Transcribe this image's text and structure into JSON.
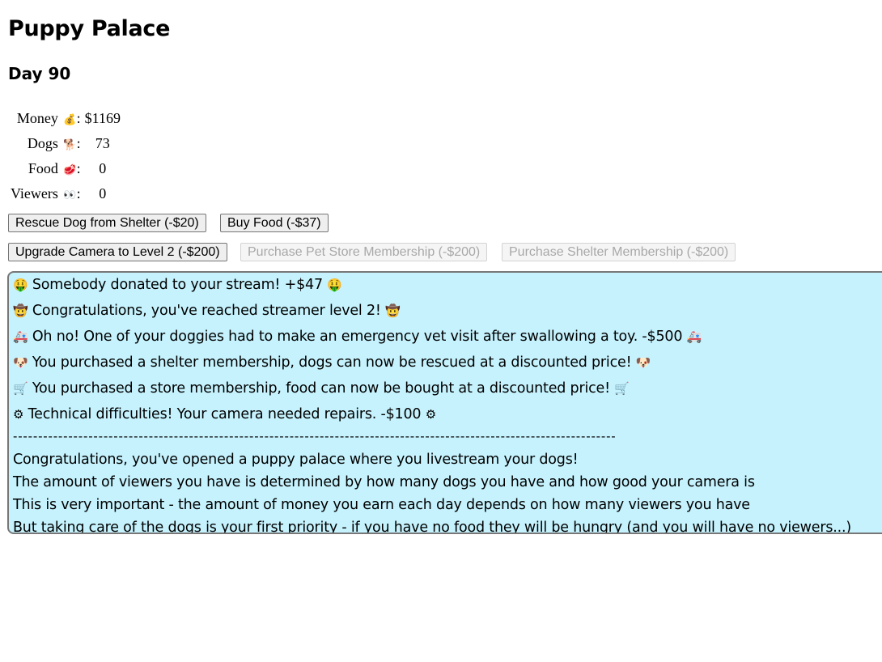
{
  "app": {
    "title": "Puppy Palace",
    "day_label": "Day 90"
  },
  "stats": [
    {
      "label": "Money",
      "icon": "money-bag-icon",
      "glyph": "💰",
      "value": "$1169"
    },
    {
      "label": "Dogs",
      "icon": "dog-icon",
      "glyph": "🐕",
      "value": "73"
    },
    {
      "label": "Food",
      "icon": "meat-icon",
      "glyph": "🥩",
      "value": "0"
    },
    {
      "label": "Viewers",
      "icon": "eyes-icon",
      "glyph": "👀",
      "value": "0"
    }
  ],
  "stat_separator": ":",
  "actions": {
    "rescue_dog": "Rescue Dog from Shelter (-$20)",
    "buy_food": "Buy Food (-$37)",
    "upgrade_camera": "Upgrade Camera to Level 2 (-$200)",
    "pet_store_membership": "Purchase Pet Store Membership (-$200)",
    "shelter_membership": "Purchase Shelter Membership (-$200)"
  },
  "log": {
    "events": [
      {
        "icon": "money-face-icon",
        "glyph": "🤑",
        "text": "Somebody donated to your stream! +$47"
      },
      {
        "icon": "cowboy-face-icon",
        "glyph": "🤠",
        "text": "Congratulations, you've reached streamer level 2!"
      },
      {
        "icon": "ambulance-icon",
        "glyph": "🚑",
        "text": "Oh no! One of your doggies had to make an emergency vet visit after swallowing a toy. -$500"
      },
      {
        "icon": "dog-face-icon",
        "glyph": "🐶",
        "text": "You purchased a shelter membership, dogs can now be rescued at a discounted price!"
      },
      {
        "icon": "shopping-cart-icon",
        "glyph": "🛒",
        "text": "You purchased a store membership, food can now be bought at a discounted price!"
      },
      {
        "icon": "gear-icon",
        "glyph": "⚙",
        "text": "Technical difficulties! Your camera needed repairs. -$100"
      }
    ],
    "separator": "------------------------------------------------------------------------------------------------------------------------",
    "intro": [
      "Congratulations, you've opened a puppy palace where you livestream your dogs!",
      "The amount of viewers you have is determined by how many dogs you have and how good your camera is",
      "This is very important - the amount of money you earn each day depends on how many viewers you have",
      "But taking care of the dogs is your first priority - if you have no food they will be hungry (and you will have no viewers...)"
    ]
  }
}
